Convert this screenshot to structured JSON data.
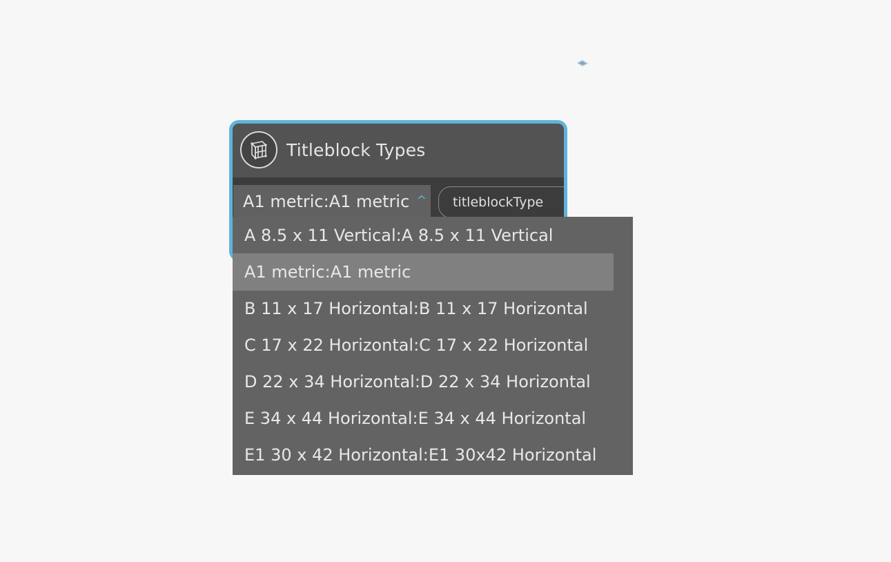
{
  "node": {
    "title": "Titleblock Types",
    "selected_value": "A1 metric:A1 metric",
    "output_port_label": "titleblockType",
    "icon": "titleblock-node-icon",
    "chevron_icon": "chevron-up-icon"
  },
  "dropdown": {
    "items": [
      {
        "label": "A 8.5 x 11 Vertical:A 8.5 x 11 Vertical",
        "selected": false
      },
      {
        "label": "A1 metric:A1 metric",
        "selected": true
      },
      {
        "label": "B 11 x 17 Horizontal:B 11 x 17 Horizontal",
        "selected": false
      },
      {
        "label": "C 17 x 22 Horizontal:C 17 x 22 Horizontal",
        "selected": false
      },
      {
        "label": "D 22 x 34 Horizontal:D 22 x 34 Horizontal",
        "selected": false
      },
      {
        "label": "E 34 x 44 Horizontal:E 34 x 44 Horizontal",
        "selected": false
      },
      {
        "label": "E1 30 x 42 Horizontal:E1 30x42 Horizontal",
        "selected": false
      }
    ]
  },
  "colors": {
    "accent": "#5fb3d9",
    "node_background": "#535353",
    "dropdown_background": "#636363",
    "dropdown_selected": "#808080",
    "canvas": "#f7f7f7"
  }
}
